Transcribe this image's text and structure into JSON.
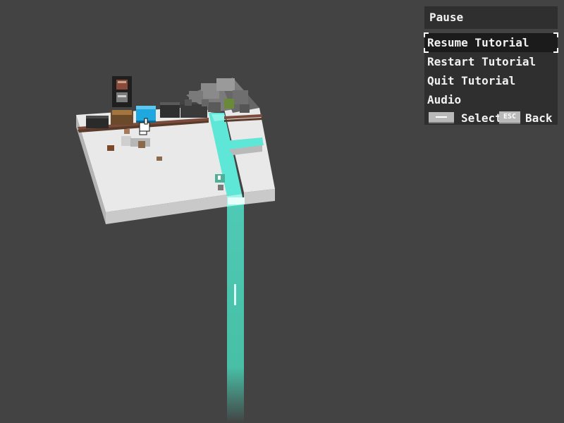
{
  "pause_menu": {
    "title": "Pause",
    "items": [
      {
        "label": "Resume Tutorial",
        "selected": true
      },
      {
        "label": "Restart Tutorial",
        "selected": false
      },
      {
        "label": "Quit Tutorial",
        "selected": false
      },
      {
        "label": "Audio",
        "selected": false
      }
    ],
    "controls": {
      "select_key_icon": "spacebar-key-icon",
      "select_label": "Select",
      "back_key": "ESC",
      "back_label": "Back"
    }
  },
  "colors": {
    "background": "#434343",
    "menu_panel": "#2f2f2f",
    "menu_selected": "#1b1b1b",
    "water": "#5ee6d6",
    "selected_wagon": "#1fa8e0"
  }
}
